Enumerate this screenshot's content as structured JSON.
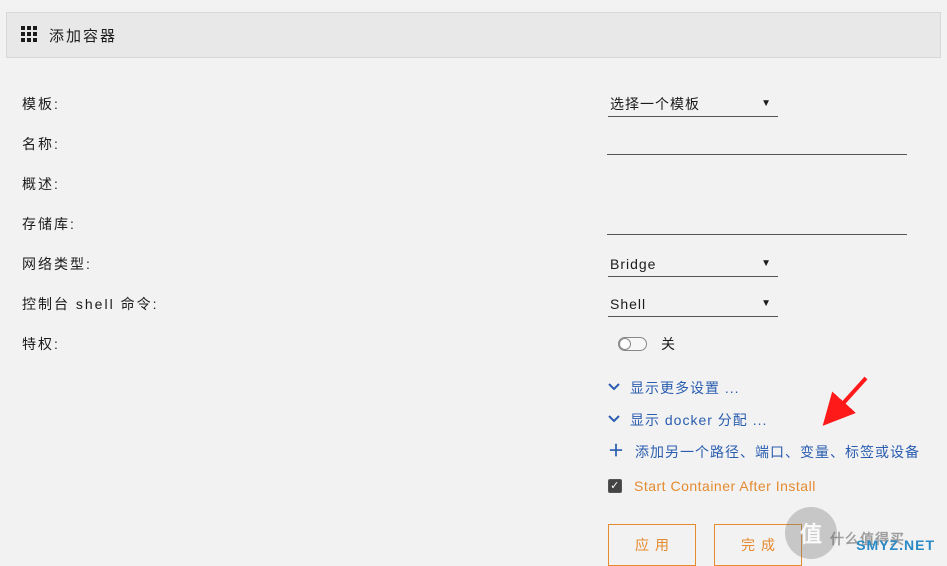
{
  "header": {
    "title": "添加容器"
  },
  "labels": {
    "template": "模板:",
    "name": "名称:",
    "overview": "概述:",
    "repository": "存储库:",
    "network_type": "网络类型:",
    "console_shell": "控制台 shell 命令:",
    "privileged": "特权:"
  },
  "fields": {
    "template_select": "选择一个模板",
    "name_value": "",
    "repository_value": "",
    "network_type_value": "Bridge",
    "console_shell_value": "Shell",
    "privileged_state": "关"
  },
  "links": {
    "show_more": "显示更多设置 ...",
    "show_docker": "显示 docker 分配 ...",
    "add_path": "添加另一个路径、端口、变量、标签或设备"
  },
  "checkbox": {
    "start_after_install": "Start Container After Install",
    "checked": true
  },
  "buttons": {
    "apply": "应用",
    "done": "完成"
  },
  "watermark": {
    "site": "SMYZ.NET",
    "badge": "值",
    "tag": "什么值得买"
  },
  "colors": {
    "link": "#2a5db0",
    "accent": "#e58a2e",
    "arrow": "#ff1a1a"
  }
}
